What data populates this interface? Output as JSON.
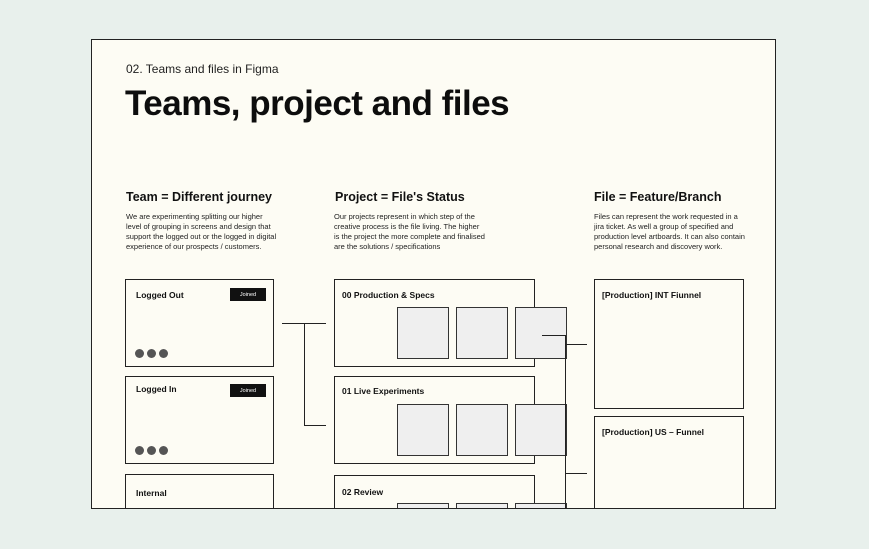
{
  "page": {
    "subtitle": "02. Teams and files in Figma",
    "title": "Teams, project and files"
  },
  "columns": [
    {
      "heading": "Team = Different journey",
      "description": "We are experimenting splitting our higher level of grouping in screens and design that support the logged out or the logged in digital experience of our prospects / customers."
    },
    {
      "heading": "Project = File's Status",
      "description": "Our projects represent in which step of the creative process is the file living. The higher is the project the more complete and finalised are the solutions / specifications"
    },
    {
      "heading": "File = Feature/Branch",
      "description": "Files can represent the work requested in a jira ticket. As well a group of specified and production level artboards. It can also contain personal research and discovery work."
    }
  ],
  "teams": [
    {
      "label": "Logged Out",
      "badge": "Joined"
    },
    {
      "label": "Logged In",
      "badge": "Joined"
    },
    {
      "label": "Internal"
    }
  ],
  "projects": [
    {
      "label": "00 Production & Specs"
    },
    {
      "label": "01 Live Experiments"
    },
    {
      "label": "02 Review"
    }
  ],
  "files": [
    {
      "label": "[Production] INT Fiunnel"
    },
    {
      "label": "[Production] US – Funnel"
    }
  ],
  "colors": {
    "background": "#e8f0ec",
    "canvas": "#fdfcf4",
    "badge": "#111111"
  }
}
